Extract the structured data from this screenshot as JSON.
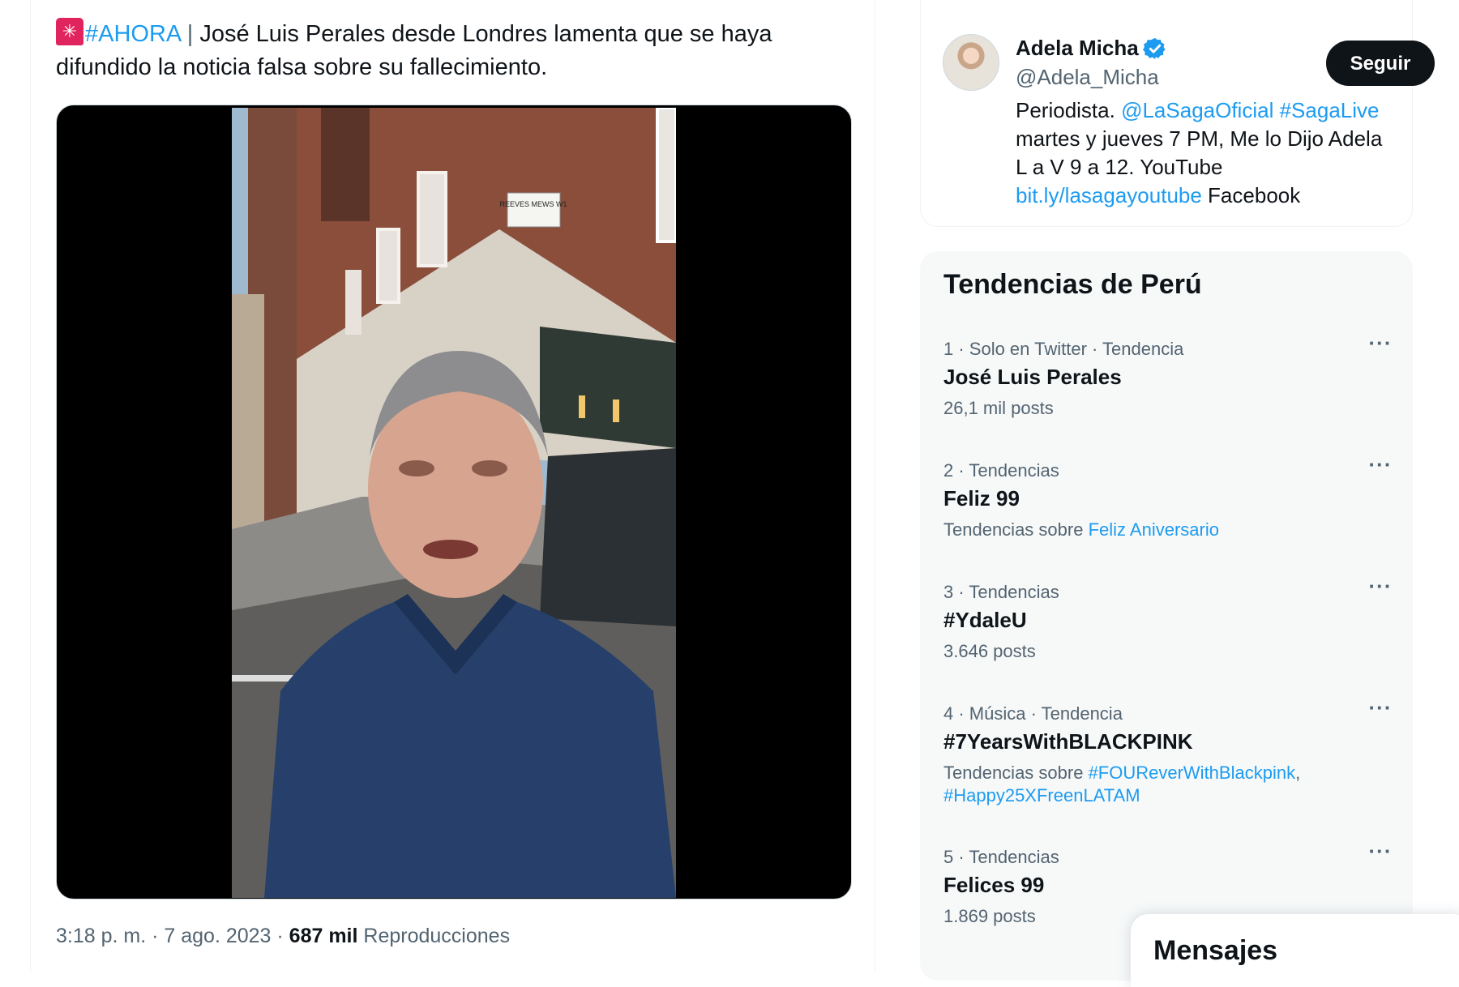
{
  "tweet": {
    "hashtag": "#AHORA",
    "separator": " | ",
    "text": "José Luis Perales desde Londres lamenta que se haya difundido la noticia falsa sobre su fallecimiento.",
    "time": "3:18 p. m. · 7 ago. 2023 · ",
    "views_count": "687 mil",
    "views_label": " Reproducciones",
    "video_sign": "REEVES MEWS W1"
  },
  "profile": {
    "name": "Adela Micha",
    "handle": "@Adela_Micha",
    "follow_label": "Seguir",
    "bio_1": "Periodista. ",
    "bio_link_1": "@LaSagaOficial",
    "bio_space": " ",
    "bio_link_2": "#SagaLive",
    "bio_2": " martes y jueves 7 PM, Me lo Dijo Adela L a V 9 a 12. YouTube ",
    "bio_link_3": "bit.ly/lasagayoutube",
    "bio_3": " Facebook"
  },
  "trends": {
    "title": "Tendencias de Perú",
    "items": [
      {
        "meta": "1 · Solo en Twitter · Tendencia",
        "name": "José Luis Perales",
        "sub": "26,1 mil posts"
      },
      {
        "meta": "2 · Tendencias",
        "name": "Feliz 99",
        "sub_prefix": "Tendencias sobre ",
        "sub_link": "Feliz Aniversario"
      },
      {
        "meta": "3 · Tendencias",
        "name": "#YdaleU",
        "sub": "3.646 posts"
      },
      {
        "meta": "4 · Música · Tendencia",
        "name": "#7YearsWithBLACKPINK",
        "sub_prefix": "Tendencias sobre ",
        "sub_link": "#FOUReverWithBlackpink",
        "sub_sep": ",",
        "sub_link_2": "#Happy25XFreenLATAM"
      },
      {
        "meta": "5 · Tendencias",
        "name": "Felices 99",
        "sub": "1.869 posts"
      }
    ],
    "more_icon": "···"
  },
  "messages": {
    "title": "Mensajes"
  },
  "colors": {
    "link": "#1d9bf0",
    "text": "#0f1419",
    "secondary": "#536471",
    "trends_bg": "#f7f9f9"
  }
}
